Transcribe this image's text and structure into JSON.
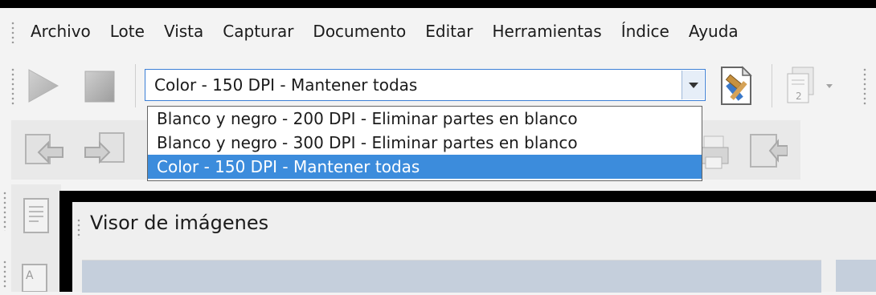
{
  "menu": {
    "items": [
      "Archivo",
      "Lote",
      "Vista",
      "Capturar",
      "Documento",
      "Editar",
      "Herramientas",
      "Índice",
      "Ayuda"
    ]
  },
  "toolbar": {
    "play_icon": "play-icon",
    "stop_icon": "stop-icon",
    "settings_icon": "document-tools-icon",
    "page_icon": "page-number-icon"
  },
  "scan_profile": {
    "selected": "Color - 150 DPI - Mantener todas",
    "options": [
      "Blanco y negro - 200 DPI - Eliminar partes en blanco",
      "Blanco y negro - 300 DPI - Eliminar partes en blanco",
      "Color - 150 DPI - Mantener todas"
    ]
  },
  "viewer": {
    "title": "Visor de imágenes"
  }
}
